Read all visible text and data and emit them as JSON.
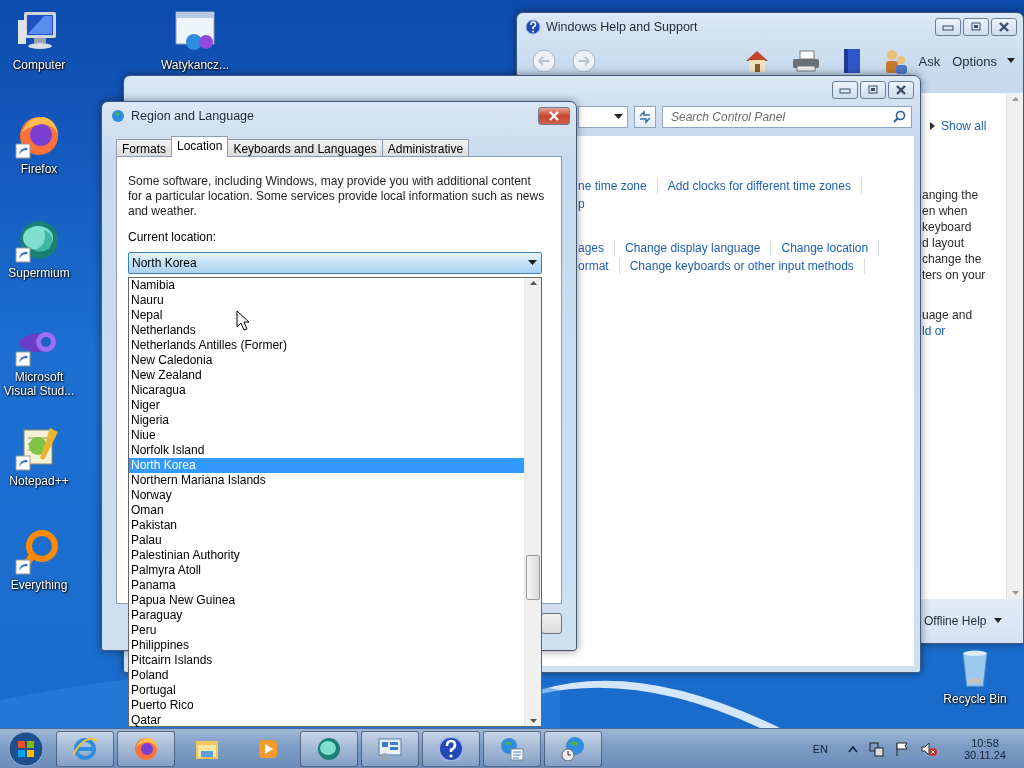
{
  "desktop": {
    "left_column": [
      {
        "label": "Computer",
        "kind": "computer",
        "shortcut": false
      },
      {
        "label": "Firefox",
        "kind": "firefox",
        "shortcut": true
      },
      {
        "label": "Supermium",
        "kind": "supermium",
        "shortcut": true
      },
      {
        "label": "Microsoft Visual Stud...",
        "kind": "visualstudio",
        "shortcut": true
      },
      {
        "label": "Notepad++",
        "kind": "notepad",
        "shortcut": true
      },
      {
        "label": "Everything",
        "kind": "everything",
        "shortcut": true
      }
    ],
    "second_column": [
      {
        "label": "Watykancz...",
        "kind": "window",
        "shortcut": false
      }
    ],
    "corner": [
      {
        "label": "Recycle Bin",
        "kind": "recycle",
        "shortcut": false
      }
    ]
  },
  "help_window": {
    "title": "Windows Help and Support",
    "ask": "Ask",
    "options": "Options",
    "sidebar": {
      "show_all": "Show all",
      "lines": [
        {
          "text": "anging the",
          "kind": "text"
        },
        {
          "text": "en when",
          "kind": "text"
        },
        {
          "text": "keyboard",
          "kind": "text"
        },
        {
          "text": "d layout",
          "kind": "text"
        },
        {
          "text": "change the",
          "kind": "text"
        },
        {
          "text": "ters on your",
          "kind": "text"
        },
        {
          "text": "uage and",
          "kind": "gap"
        },
        {
          "text": "ld or",
          "kind": "link"
        }
      ]
    },
    "footer": "Offline Help"
  },
  "control_panel": {
    "search_placeholder": "Search Control Panel",
    "groups": [
      {
        "rows": [
          [
            "ne time zone",
            "Add clocks for different time zones"
          ],
          [
            "p"
          ]
        ]
      },
      {
        "rows": [
          [
            "ages",
            "Change display language",
            "Change location"
          ],
          [
            "ormat",
            "Change keyboards or other input methods"
          ]
        ]
      }
    ]
  },
  "dialog": {
    "title": "Region and Language",
    "tabs": [
      {
        "label": "Formats",
        "selected": false
      },
      {
        "label": "Location",
        "selected": true
      },
      {
        "label": "Keyboards and Languages",
        "selected": false
      },
      {
        "label": "Administrative",
        "selected": false
      }
    ],
    "description": "Some software, including Windows, may provide you with additional content for a particular location. Some services provide local information such as news and weather.",
    "location_label": "Current location:",
    "location_value": "North Korea",
    "options": [
      {
        "label": "Namibia",
        "selected": false
      },
      {
        "label": "Nauru",
        "selected": false
      },
      {
        "label": "Nepal",
        "selected": false
      },
      {
        "label": "Netherlands",
        "selected": false
      },
      {
        "label": "Netherlands Antilles (Former)",
        "selected": false
      },
      {
        "label": "New Caledonia",
        "selected": false
      },
      {
        "label": "New Zealand",
        "selected": false
      },
      {
        "label": "Nicaragua",
        "selected": false
      },
      {
        "label": "Niger",
        "selected": false
      },
      {
        "label": "Nigeria",
        "selected": false
      },
      {
        "label": "Niue",
        "selected": false
      },
      {
        "label": "Norfolk Island",
        "selected": false
      },
      {
        "label": "North Korea",
        "selected": true
      },
      {
        "label": "Northern Mariana Islands",
        "selected": false
      },
      {
        "label": "Norway",
        "selected": false
      },
      {
        "label": "Oman",
        "selected": false
      },
      {
        "label": "Pakistan",
        "selected": false
      },
      {
        "label": "Palau",
        "selected": false
      },
      {
        "label": "Palestinian Authority",
        "selected": false
      },
      {
        "label": "Palmyra Atoll",
        "selected": false
      },
      {
        "label": "Panama",
        "selected": false
      },
      {
        "label": "Papua New Guinea",
        "selected": false
      },
      {
        "label": "Paraguay",
        "selected": false
      },
      {
        "label": "Peru",
        "selected": false
      },
      {
        "label": "Philippines",
        "selected": false
      },
      {
        "label": "Pitcairn Islands",
        "selected": false
      },
      {
        "label": "Poland",
        "selected": false
      },
      {
        "label": "Portugal",
        "selected": false
      },
      {
        "label": "Puerto Rico",
        "selected": false
      },
      {
        "label": "Qatar",
        "selected": false
      }
    ]
  },
  "taskbar": {
    "buttons": [
      {
        "kind": "ie",
        "running": true
      },
      {
        "kind": "firefox",
        "running": true
      },
      {
        "kind": "explorer",
        "running": false
      },
      {
        "kind": "media",
        "running": false
      },
      {
        "kind": "supermium",
        "running": true
      },
      {
        "kind": "controlpanel",
        "running": true
      },
      {
        "kind": "help",
        "running": true
      },
      {
        "kind": "region",
        "running": true
      },
      {
        "kind": "datetime",
        "running": true
      }
    ],
    "language": "EN",
    "time": "10:58",
    "date": "30.11.24"
  }
}
